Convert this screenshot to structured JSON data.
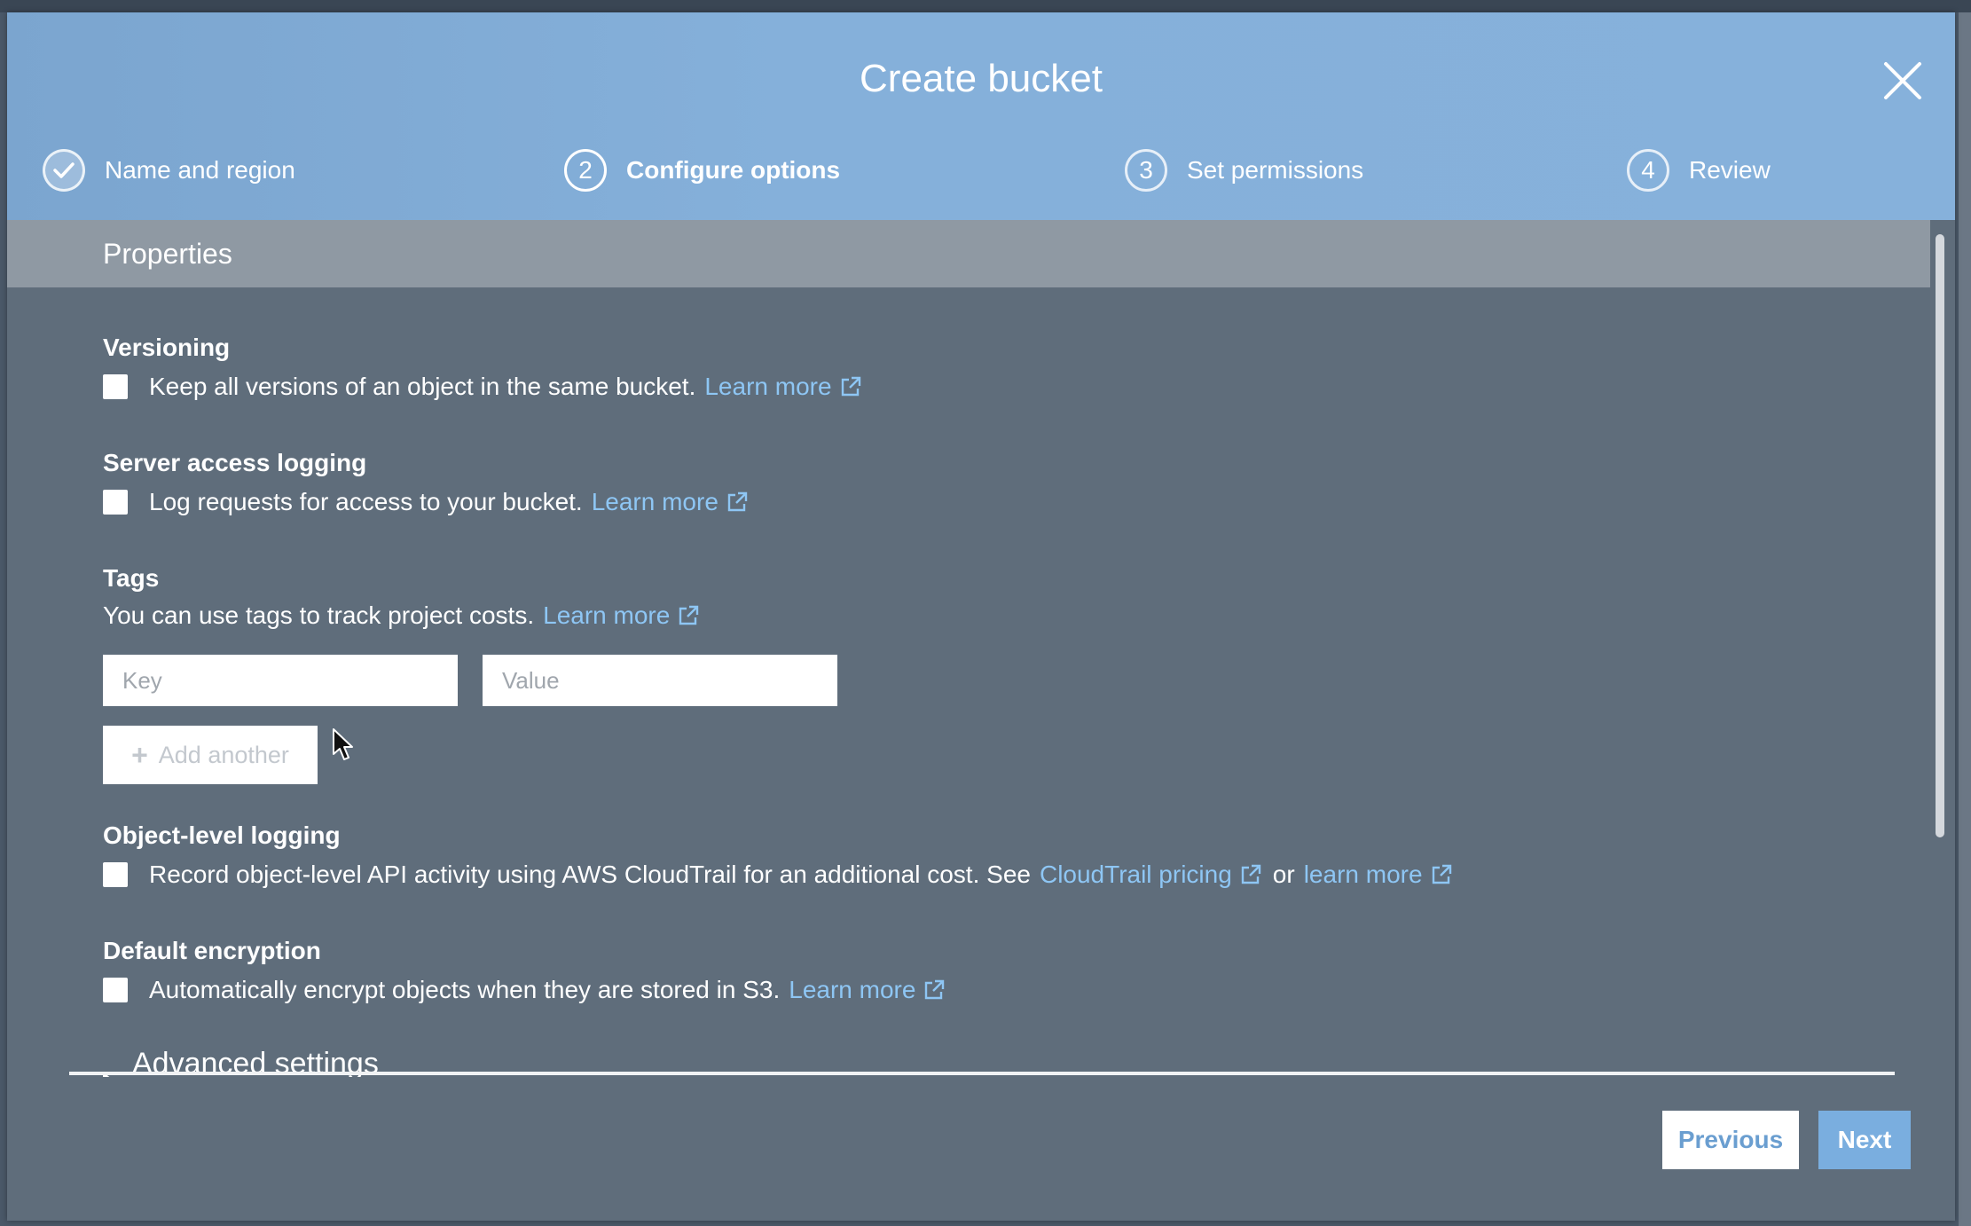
{
  "dialog": {
    "title": "Create bucket"
  },
  "steps": [
    {
      "number": "",
      "label": "Name and region",
      "state": "completed"
    },
    {
      "number": "2",
      "label": "Configure options",
      "state": "active"
    },
    {
      "number": "3",
      "label": "Set permissions",
      "state": "pending"
    },
    {
      "number": "4",
      "label": "Review",
      "state": "pending"
    }
  ],
  "properties": {
    "heading": "Properties",
    "versioning": {
      "title": "Versioning",
      "text": "Keep all versions of an object in the same bucket.",
      "link": "Learn more",
      "checked": false
    },
    "server_access_logging": {
      "title": "Server access logging",
      "text": "Log requests for access to your bucket.",
      "link": "Learn more",
      "checked": false
    },
    "tags": {
      "title": "Tags",
      "text": "You can use tags to track project costs.",
      "link": "Learn more",
      "key_placeholder": "Key",
      "value_placeholder": "Value",
      "add_label": "Add another"
    },
    "object_level_logging": {
      "title": "Object-level logging",
      "text": "Record object-level API activity using AWS CloudTrail for an additional cost. See",
      "link1": "CloudTrail pricing",
      "joiner": "or",
      "link2": "learn more",
      "checked": false
    },
    "default_encryption": {
      "title": "Default encryption",
      "text": "Automatically encrypt objects when they are stored in S3.",
      "link": "Learn more",
      "checked": false
    },
    "advanced": {
      "label": "Advanced settings"
    }
  },
  "footer": {
    "previous_label": "Previous",
    "next_label": "Next"
  },
  "colors": {
    "header": "#85b0da",
    "body": "#5f6d7b",
    "link": "#8ec6f4",
    "primary_button": "#7aaedf"
  }
}
